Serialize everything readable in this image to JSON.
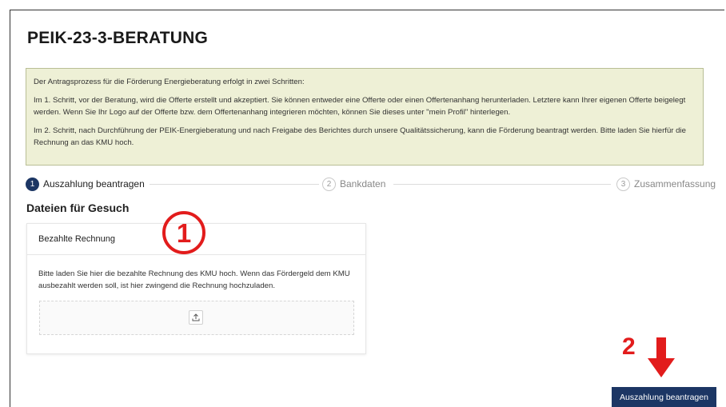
{
  "page": {
    "title": "PEIK-23-3-BERATUNG"
  },
  "info": {
    "paragraphs": [
      "Der Antragsprozess für die Förderung Energieberatung erfolgt in zwei Schritten:",
      "Im 1. Schritt, vor der Beratung, wird die Offerte erstellt und akzeptiert. Sie können entweder eine Offerte oder einen Offertenanhang herunterladen. Letztere kann Ihrer eigenen Offerte beigelegt werden. Wenn Sie Ihr Logo auf der Offerte bzw. dem Offertenanhang integrieren möchten, können Sie dieses unter \"mein Profil\" hinterlegen.",
      "Im 2. Schritt, nach Durchführung der PEIK-Energieberatung und nach Freigabe des Berichtes durch unsere Qualitätssicherung, kann die Förderung beantragt werden. Bitte laden Sie hierfür die Rechnung an das KMU hoch."
    ]
  },
  "stepper": {
    "steps": [
      {
        "number": "1",
        "label": "Auszahlung beantragen",
        "state": "active"
      },
      {
        "number": "2",
        "label": "Bankdaten",
        "state": "inactive"
      },
      {
        "number": "3",
        "label": "Zusammenfassung",
        "state": "inactive"
      }
    ]
  },
  "section": {
    "title": "Dateien für Gesuch"
  },
  "card": {
    "title": "Bezahlte Rechnung",
    "description": "Bitte laden Sie hier die bezahlte Rechnung des KMU hoch. Wenn das Fördergeld dem KMU ausbezahlt werden soll, ist hier zwingend die Rechnung hochzuladen.",
    "upload_icon": "upload-icon"
  },
  "annotations": {
    "marker_1": "1",
    "marker_2": "2"
  },
  "actions": {
    "submit_label": "Auszahlung beantragen"
  },
  "colors": {
    "primary": "#1c3664",
    "info_bg": "#eef0d6",
    "annotation": "#e21c1c"
  }
}
